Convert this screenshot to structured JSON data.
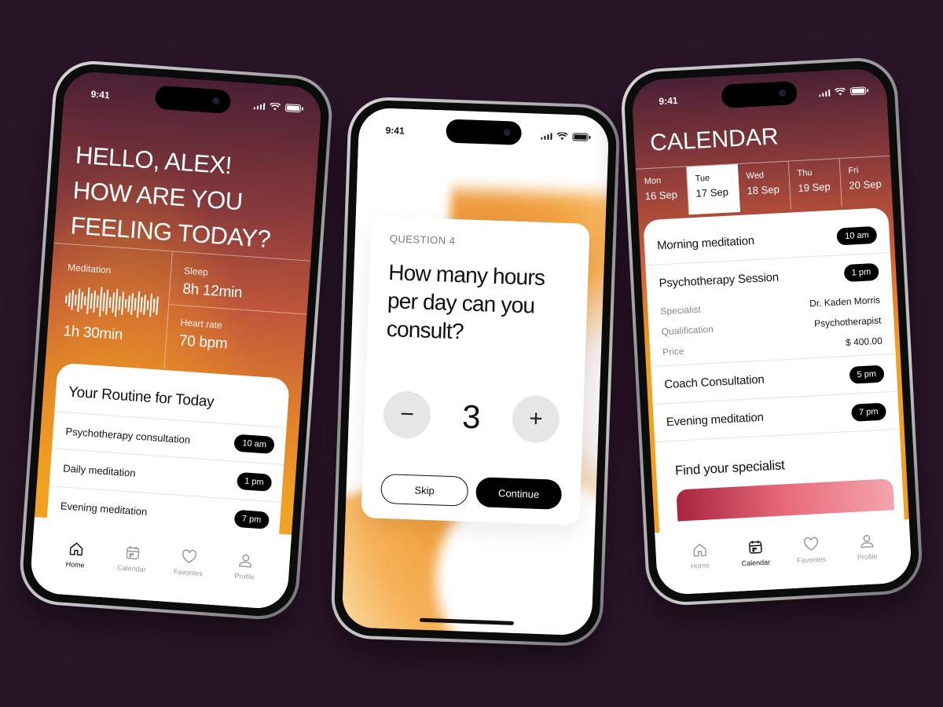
{
  "phone1": {
    "status": {
      "time": "9:41"
    },
    "greeting": [
      "HELLO, ALEX!",
      "HOW ARE YOU",
      "FEELING TODAY?"
    ],
    "stats": {
      "meditation": {
        "label": "Meditation",
        "value": "1h 30min"
      },
      "sleep": {
        "label": "Sleep",
        "value": "8h 12min"
      },
      "heart": {
        "label": "Heart rate",
        "value": "70 bpm"
      }
    },
    "routine": {
      "title": "Your Routine for Today",
      "items": [
        {
          "label": "Psychotherapy consultation",
          "time": "10 am"
        },
        {
          "label": "Daily meditation",
          "time": "1 pm"
        },
        {
          "label": "Evening meditation",
          "time": "7 pm"
        }
      ]
    },
    "tabs": [
      {
        "label": "Home",
        "icon": "home-icon"
      },
      {
        "label": "Calendar",
        "icon": "calendar-icon"
      },
      {
        "label": "Favorites",
        "icon": "heart-icon"
      },
      {
        "label": "Profile",
        "icon": "profile-icon"
      }
    ]
  },
  "phone2": {
    "status": {
      "time": "9:41"
    },
    "question_number": "QUESTION 4",
    "question": "How many hours per day can you consult?",
    "stepper": {
      "value": "3",
      "minus": "−",
      "plus": "+"
    },
    "skip_label": "Skip",
    "continue_label": "Continue"
  },
  "phone3": {
    "status": {
      "time": "9:41"
    },
    "title": "CALENDAR",
    "days": [
      {
        "name": "Mon",
        "date": "16 Sep"
      },
      {
        "name": "Tue",
        "date": "17 Sep"
      },
      {
        "name": "Wed",
        "date": "18 Sep"
      },
      {
        "name": "Thu",
        "date": "19 Sep"
      },
      {
        "name": "Fri",
        "date": "20 Sep"
      }
    ],
    "selected_day": "Tue",
    "events": {
      "morning": {
        "label": "Morning meditation",
        "time": "10 am"
      },
      "session": {
        "label": "Psychotherapy Session",
        "time": "1 pm",
        "specialist_label": "Specialist",
        "specialist": "Dr. Kaden Morris",
        "qualification_label": "Qualification",
        "qualification": "Psychotherapist",
        "price_label": "Price",
        "price": "$ 400.00"
      },
      "coach": {
        "label": "Coach Consultation",
        "time": "5 pm"
      },
      "evening": {
        "label": "Evening meditation",
        "time": "7 pm"
      }
    },
    "find_title": "Find your specialist",
    "tabs": [
      {
        "label": "Home",
        "icon": "home-icon"
      },
      {
        "label": "Calendar",
        "icon": "calendar-icon"
      },
      {
        "label": "Favorites",
        "icon": "heart-icon"
      },
      {
        "label": "Profile",
        "icon": "profile-icon"
      }
    ]
  },
  "colors": {
    "background": "#2a1528",
    "gradient_top": "#4a2035",
    "gradient_mid": "#c9593a",
    "gradient_bottom": "#f1a024",
    "pill": "#000000",
    "accent_card": "#e86a7a"
  }
}
